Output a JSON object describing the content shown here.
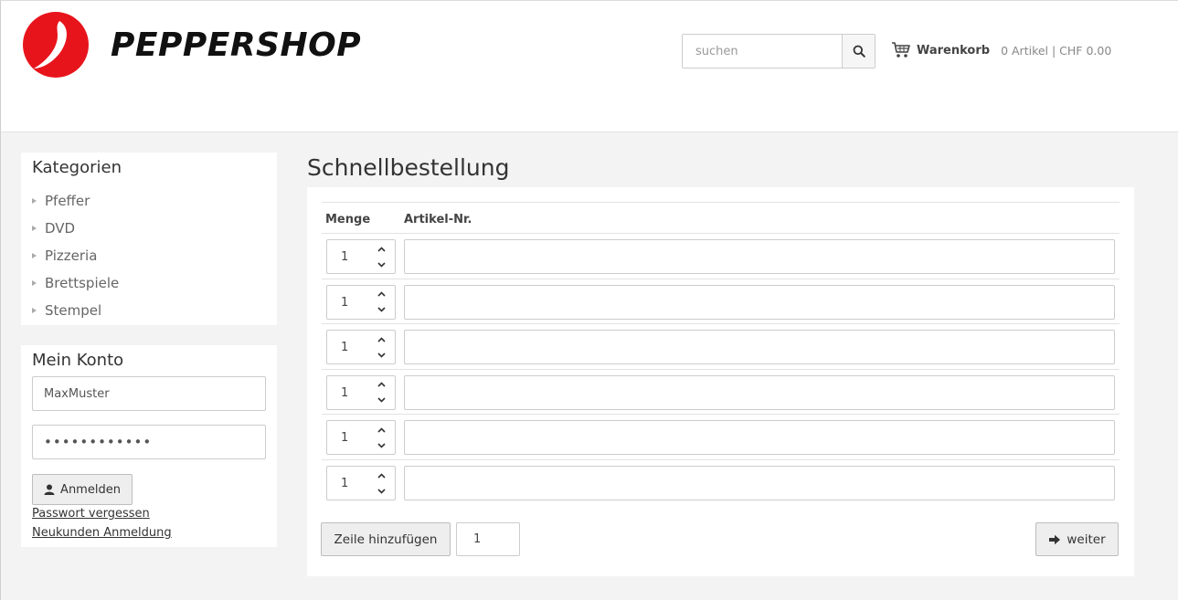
{
  "header": {
    "logo_text": "PEPPERSHOP",
    "logo_icon": "pepper-logo-icon",
    "brand_color": "#e8141c",
    "search": {
      "placeholder": "suchen",
      "icon": "search-icon"
    },
    "cart": {
      "icon": "cart-icon",
      "label": "Warenkorb",
      "info": "0 Artikel | CHF 0.00"
    }
  },
  "sidebar": {
    "categories": {
      "title": "Kategorien",
      "items": [
        {
          "label": "Pfeffer"
        },
        {
          "label": "DVD"
        },
        {
          "label": "Pizzeria"
        },
        {
          "label": "Brettspiele"
        },
        {
          "label": "Stempel"
        }
      ]
    },
    "account": {
      "title": "Mein Konto",
      "username_value": "MaxMuster",
      "password_value": "••••••••••••",
      "login_label": "Anmelden",
      "forgot_password": "Passwort vergessen",
      "register": "Neukunden Anmeldung"
    }
  },
  "main": {
    "title": "Schnellbestellung",
    "columns": {
      "qty": "Menge",
      "article": "Artikel-Nr."
    },
    "rows": [
      {
        "qty": "1",
        "article": ""
      },
      {
        "qty": "1",
        "article": ""
      },
      {
        "qty": "1",
        "article": ""
      },
      {
        "qty": "1",
        "article": ""
      },
      {
        "qty": "1",
        "article": ""
      },
      {
        "qty": "1",
        "article": ""
      }
    ],
    "add_row_label": "Zeile hinzufügen",
    "add_row_count": "1",
    "next_label": "weiter"
  }
}
